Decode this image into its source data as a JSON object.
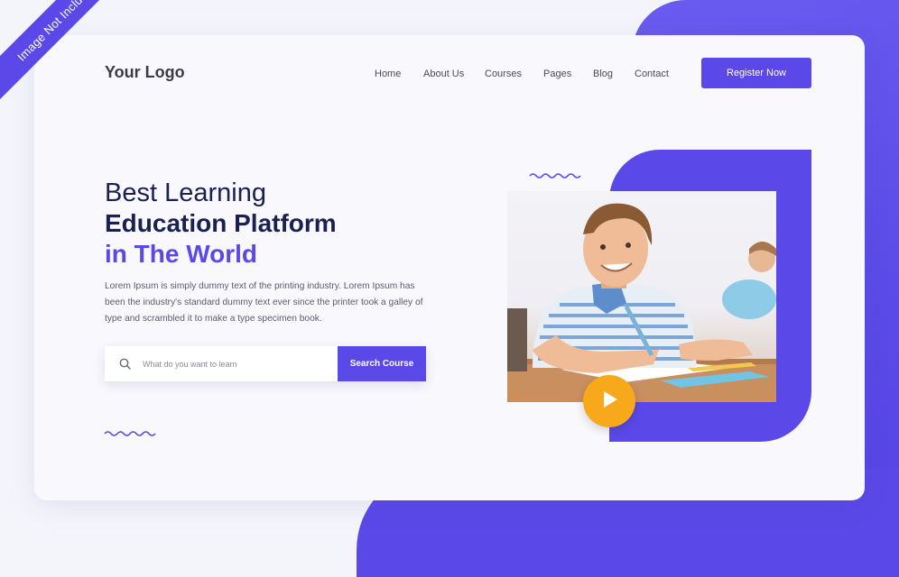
{
  "ribbon": {
    "text": "Image Not Included"
  },
  "header": {
    "logo": "Your Logo",
    "nav": [
      "Home",
      "About Us",
      "Courses",
      "Pages",
      "Blog",
      "Contact"
    ],
    "register_label": "Register Now"
  },
  "hero": {
    "line1": "Best Learning",
    "line2": "Education Platform",
    "line3": "in The World",
    "description": "Lorem Ipsum is simply dummy text of the printing industry. Lorem Ipsum has been the industry's standard dummy text ever since the printer took a galley of type and scrambled it to make a type specimen book."
  },
  "search": {
    "placeholder": "What do you want to learn",
    "button_label": "Search Course"
  },
  "icons": {
    "search": "search-icon",
    "play": "play-icon"
  },
  "colors": {
    "accent": "#5a49e8",
    "navy": "#1a2150",
    "play": "#f7a81b",
    "card": "#f8f8fd"
  }
}
